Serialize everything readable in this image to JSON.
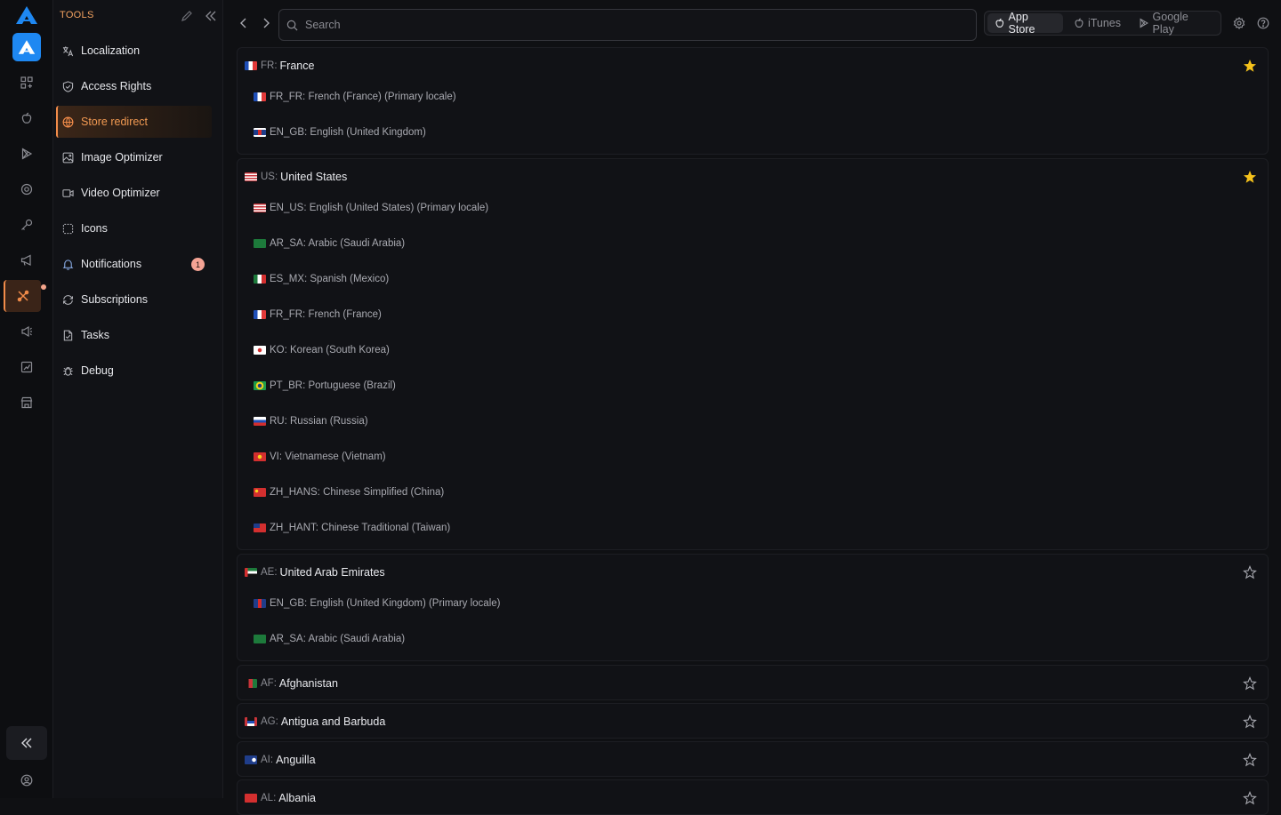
{
  "colors": {
    "accent": "#f28c4a",
    "brand": "#1e88f2",
    "star_filled": "#f5c21b"
  },
  "rail": {
    "items": [
      {
        "icon": "apps-icon"
      },
      {
        "icon": "apple-icon"
      },
      {
        "icon": "play-icon"
      },
      {
        "icon": "target-icon"
      },
      {
        "icon": "key-icon"
      },
      {
        "icon": "megaphone-icon"
      },
      {
        "icon": "tools-icon",
        "active": true
      },
      {
        "icon": "ads-icon"
      },
      {
        "icon": "chart-icon"
      },
      {
        "icon": "store-icon"
      }
    ]
  },
  "panel": {
    "title": "TOOLS",
    "items": [
      {
        "label": "Localization",
        "icon": "translate-icon"
      },
      {
        "label": "Access Rights",
        "icon": "shield-icon"
      },
      {
        "label": "Store redirect",
        "icon": "globe-icon",
        "active": true
      },
      {
        "label": "Image Optimizer",
        "icon": "image-icon"
      },
      {
        "label": "Video Optimizer",
        "icon": "video-icon"
      },
      {
        "label": "Icons",
        "icon": "icons-icon"
      },
      {
        "label": "Notifications",
        "icon": "bell-icon",
        "badge": "1"
      },
      {
        "label": "Subscriptions",
        "icon": "refresh-icon"
      },
      {
        "label": "Tasks",
        "icon": "file-icon"
      },
      {
        "label": "Debug",
        "icon": "bug-icon"
      }
    ]
  },
  "search": {
    "placeholder": "Search"
  },
  "stores": [
    {
      "label": "App Store",
      "icon": "apple-icon",
      "active": true
    },
    {
      "label": "iTunes",
      "icon": "apple-icon"
    },
    {
      "label": "Google Play",
      "icon": "play-icon"
    }
  ],
  "countries": [
    {
      "code": "FR:",
      "name": "France",
      "favorite": true,
      "locales": [
        "FR_FR: French (France) (Primary locale)",
        "EN_GB: English (United Kingdom)"
      ]
    },
    {
      "code": "US:",
      "name": "United States",
      "favorite": true,
      "locales": [
        "EN_US: English (United States) (Primary locale)",
        "AR_SA: Arabic (Saudi Arabia)",
        "ES_MX: Spanish (Mexico)",
        "FR_FR: French (France)",
        "KO: Korean (South Korea)",
        "PT_BR: Portuguese (Brazil)",
        "RU: Russian (Russia)",
        "VI: Vietnamese (Vietnam)",
        "ZH_HANS: Chinese Simplified (China)",
        "ZH_HANT: Chinese Traditional (Taiwan)"
      ]
    },
    {
      "code": "AE:",
      "name": "United Arab Emirates",
      "favorite": false,
      "locales": [
        "EN_GB: English (United Kingdom) (Primary locale)",
        "AR_SA: Arabic (Saudi Arabia)"
      ]
    },
    {
      "code": "AF:",
      "name": "Afghanistan",
      "favorite": false,
      "locales": []
    },
    {
      "code": "AG:",
      "name": "Antigua and Barbuda",
      "favorite": false,
      "locales": []
    },
    {
      "code": "AI:",
      "name": "Anguilla",
      "favorite": false,
      "locales": []
    },
    {
      "code": "AL:",
      "name": "Albania",
      "favorite": false,
      "locales": []
    }
  ]
}
